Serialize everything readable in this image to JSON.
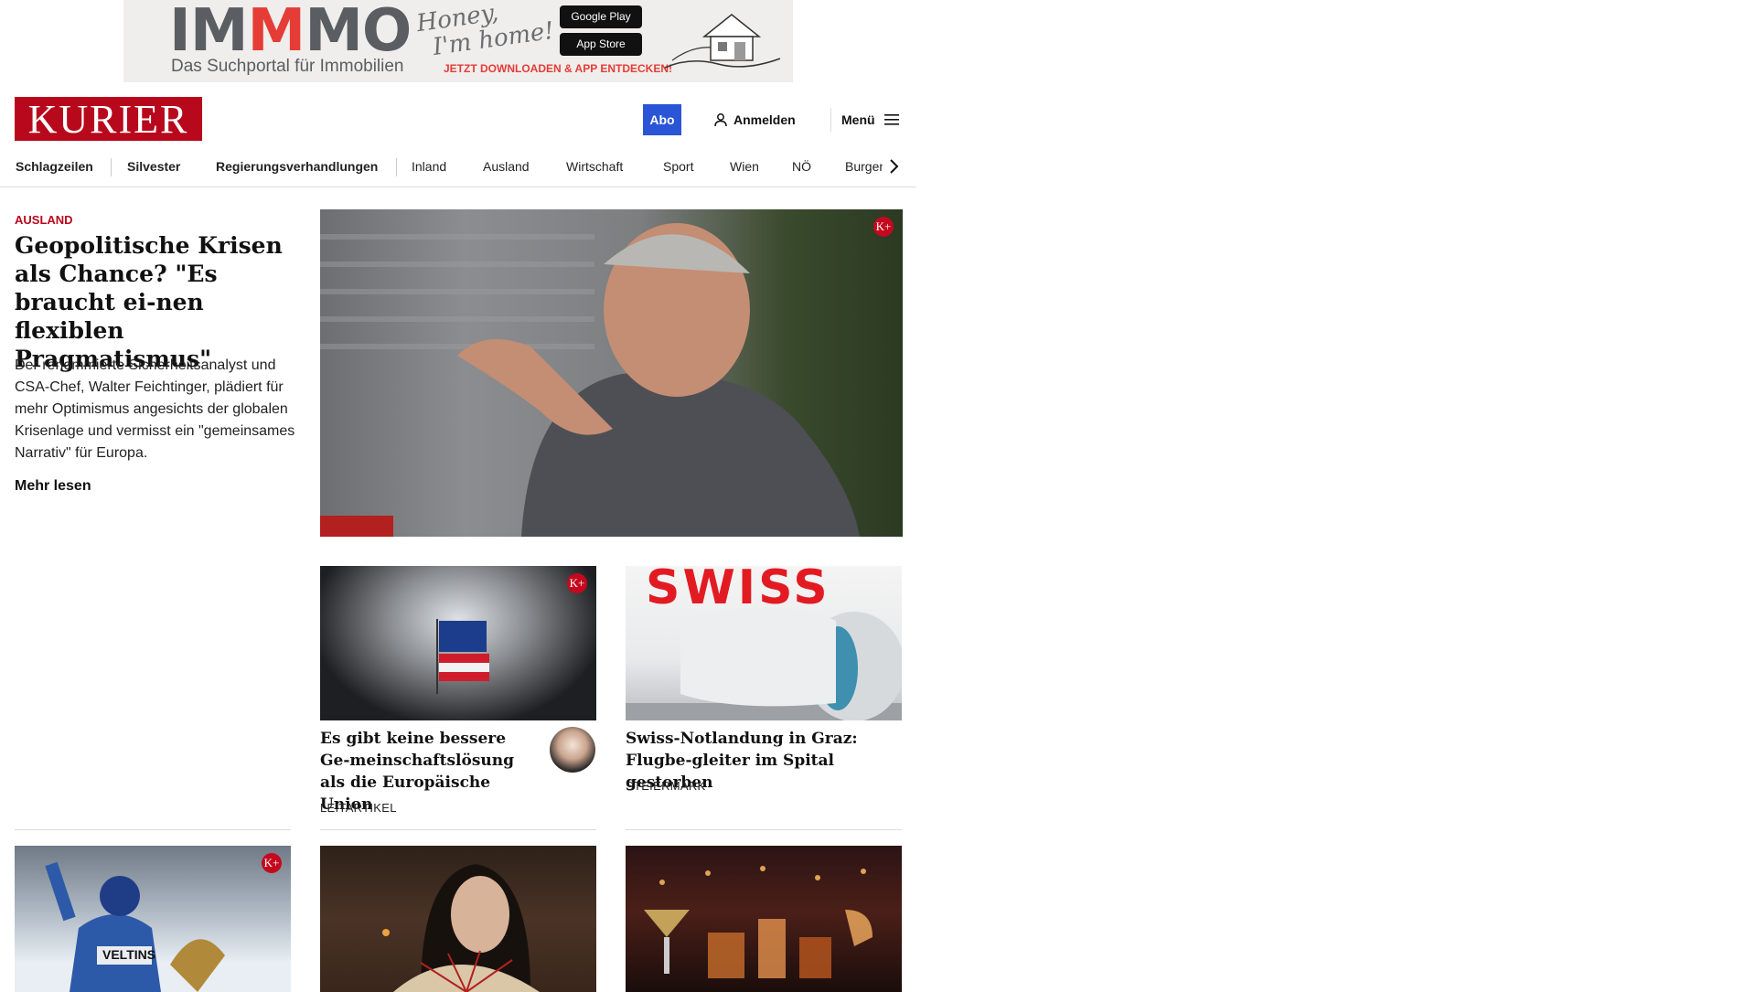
{
  "ad": {
    "logo_prefix": "IM",
    "logo_m": "M",
    "logo_suffix": "MO",
    "subtitle": "Das Suchportal für Immobilien",
    "script_line1": "Honey,",
    "script_line2": "I'm home!",
    "google_play": "Google Play",
    "app_store": "App Store",
    "cta": "JETZT DOWNLOADEN & APP ENTDECKEN!",
    "brand_color": "#e53c36"
  },
  "header": {
    "logo": "KURIER",
    "abo": "Abo",
    "login": "Anmelden",
    "menu": "Menü",
    "brand_color": "#b8081c",
    "abo_color": "#2a55d6"
  },
  "nav": {
    "items": [
      "Schlagzeilen",
      "Silvester",
      "Regierungsverhandlungen",
      "Inland",
      "Ausland",
      "Wirtschaft",
      "Sport",
      "Wien",
      "NÖ",
      "Burgenl"
    ]
  },
  "lead": {
    "category": "AUSLAND",
    "title": "Geopolitische Krisen als Chance? \"Es braucht ei-nen flexiblen Pragmatismus\"",
    "teaser": "Der renommierte Sicherheitsanalyst und CSA-Chef, Walter Feichtinger, plädiert für mehr Optimismus angesichts der globalen Krisenlage und vermisst ein \"gemeinsames Narrativ\" für Europa.",
    "more": "Mehr lesen"
  },
  "badge": "K+",
  "articles": [
    {
      "title": "Es gibt keine bessere Ge-meinschaftslösung als die Europäische Union",
      "kicker": "LEITARTIKEL"
    },
    {
      "title": "Swiss-Notlandung in Graz: Flugbe-gleiter im Spital gestorben",
      "kicker": "STEIERMARK"
    }
  ],
  "swiss_livery": "SWISS",
  "ski_bib": "VELTINS"
}
